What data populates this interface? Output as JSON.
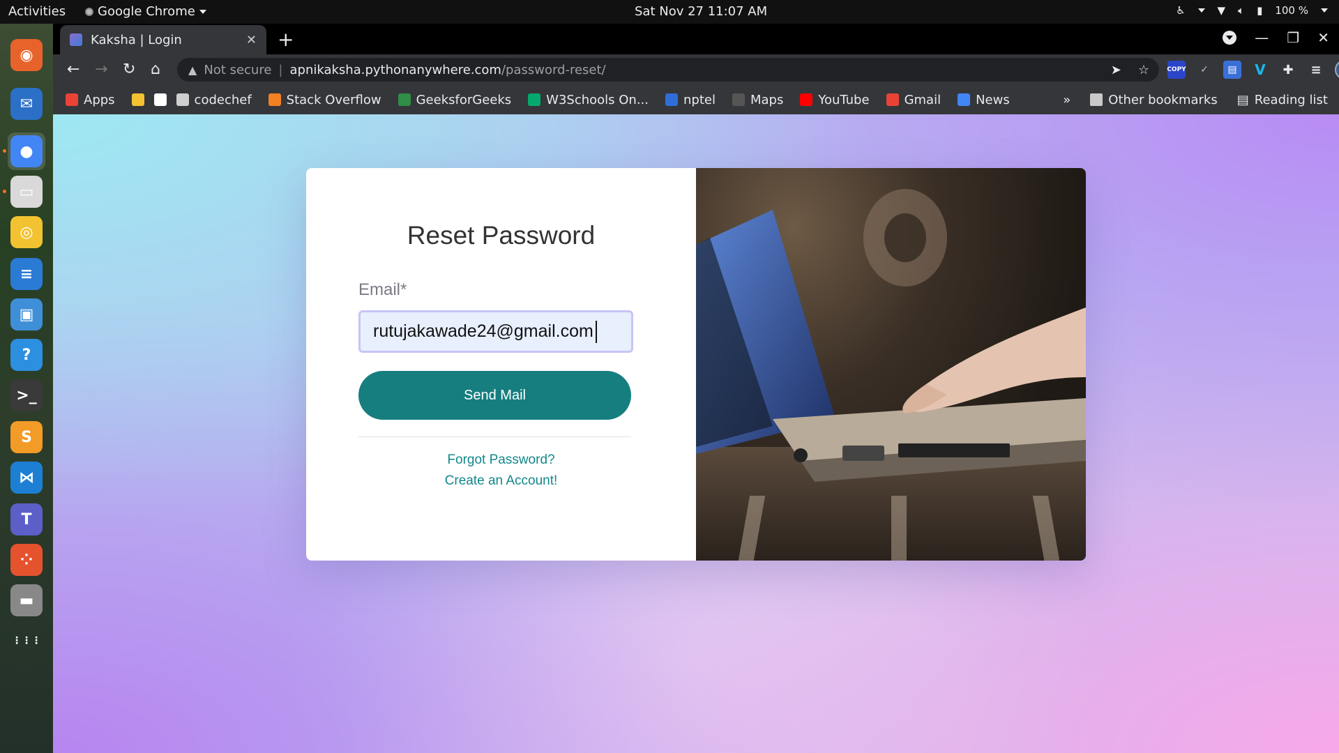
{
  "system_bar": {
    "activities": "Activities",
    "app_name": "Google Chrome",
    "clock": "Sat Nov 27  11:07 AM",
    "battery": "100 %"
  },
  "dock": {
    "apps": [
      {
        "name": "firefox-icon",
        "color": "#e8632b",
        "glyph": "◉"
      },
      {
        "name": "mail-client-icon",
        "color": "#2b6fc7",
        "glyph": "✉"
      },
      {
        "name": "chrome-icon",
        "color": "#4285f4",
        "glyph": "●"
      },
      {
        "name": "files-icon",
        "color": "#d9d9d9",
        "glyph": "▭"
      },
      {
        "name": "rhythmbox-icon",
        "color": "#f2c230",
        "glyph": "◎"
      },
      {
        "name": "writer-icon",
        "color": "#2a7bd4",
        "glyph": "≡"
      },
      {
        "name": "software-center-icon",
        "color": "#3f8fd8",
        "glyph": "▣"
      },
      {
        "name": "help-icon",
        "color": "#2d8fe0",
        "glyph": "?"
      },
      {
        "name": "terminal-icon",
        "color": "#3a3a3a",
        "glyph": ">_"
      },
      {
        "name": "sublime-text-icon",
        "color": "#f29b27",
        "glyph": "S"
      },
      {
        "name": "vscode-icon",
        "color": "#1d7fd3",
        "glyph": "⋈"
      },
      {
        "name": "teams-icon",
        "color": "#5b5fc7",
        "glyph": "T"
      },
      {
        "name": "app-red-icon",
        "color": "#e5522e",
        "glyph": "⁘"
      },
      {
        "name": "drive-icon",
        "color": "#888888",
        "glyph": "▬"
      },
      {
        "name": "show-apps-icon",
        "color": "transparent",
        "glyph": "⋮⋮⋮"
      }
    ]
  },
  "browser": {
    "tab_title": "Kaksha | Login",
    "url_security": "Not secure",
    "url_host": "apnikaksha.pythonanywhere.com",
    "url_path": "/password-reset/",
    "bookmarks": [
      {
        "label": "Apps",
        "icon_color": "#ea4335"
      },
      {
        "label": "",
        "icon_color": "#f2c230"
      },
      {
        "label": "",
        "icon_color": "#ffffff"
      },
      {
        "label": "codechef",
        "icon_color": "#cfcfcf"
      },
      {
        "label": "Stack Overflow",
        "icon_color": "#f48024"
      },
      {
        "label": "GeeksforGeeks",
        "icon_color": "#2f8d46"
      },
      {
        "label": "W3Schools On...",
        "icon_color": "#04aa6d"
      },
      {
        "label": "nptel",
        "icon_color": "#2f6dd8"
      },
      {
        "label": "Maps",
        "icon_color": "#555555"
      },
      {
        "label": "YouTube",
        "icon_color": "#ff0000"
      },
      {
        "label": "Gmail",
        "icon_color": "#ea4335"
      },
      {
        "label": "News",
        "icon_color": "#4285f4"
      }
    ],
    "other_bookmarks": "Other bookmarks",
    "reading_list": "Reading list"
  },
  "page": {
    "title": "Reset Password",
    "email_label": "Email*",
    "email_value": "rutujakawade24@gmail.com",
    "send_button": "Send Mail",
    "forgot_link": "Forgot Password?",
    "create_link": "Create an Account!"
  },
  "colors": {
    "accent": "#167e7f",
    "link": "#13878a",
    "input_bg": "#e8effd",
    "input_border": "#c7c4f6"
  }
}
